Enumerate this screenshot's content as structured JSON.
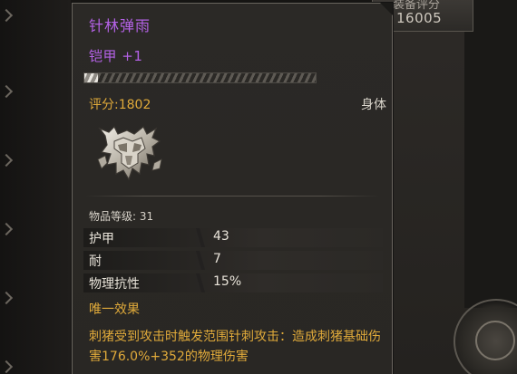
{
  "tooltip": {
    "item_name": "针林弹雨",
    "item_sub": "铠甲 +1",
    "durability_fraction": 0.06,
    "rating": "评分:1802",
    "slot": "身体",
    "item_level": "物品等级: 31",
    "stats": [
      {
        "name": "护甲",
        "value": "43"
      },
      {
        "name": "耐",
        "value": "7"
      },
      {
        "name": "物理抗性",
        "value": "15%"
      }
    ],
    "unique_title": "唯一效果",
    "unique_desc": "刺猪受到攻击时触发范围针刺攻击：造成刺猪基础伤害176.0%+352的物理伤害"
  },
  "equip_score": {
    "label": "装备评分",
    "value": "16005"
  },
  "colors": {
    "rarity_purple": "#b462e6",
    "gold_text": "#e0aa3a"
  },
  "icons": {
    "item": "armor-chestpiece-icon",
    "lock": "lock-icon"
  }
}
